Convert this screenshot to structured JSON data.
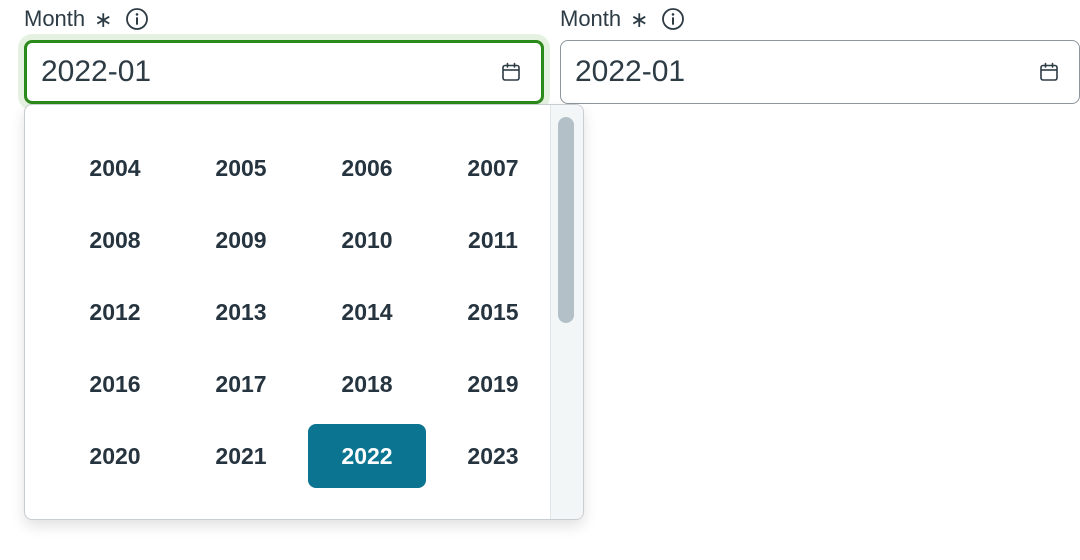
{
  "fields": [
    {
      "label": "Month",
      "required_mark": "∗",
      "value": "2022-01",
      "state": "focused"
    },
    {
      "label": "Month",
      "required_mark": "∗",
      "value": "2022-01",
      "state": "normal"
    }
  ],
  "picker": {
    "years": [
      "2004",
      "2005",
      "2006",
      "2007",
      "2008",
      "2009",
      "2010",
      "2011",
      "2012",
      "2013",
      "2014",
      "2015",
      "2016",
      "2017",
      "2018",
      "2019",
      "2020",
      "2021",
      "2022",
      "2023"
    ],
    "selected_year": "2022"
  },
  "colors": {
    "focus_border": "#2a8a1a",
    "selected_bg": "#0b7490",
    "text": "#2d3b45"
  },
  "icons": {
    "info": "info-circle-icon",
    "calendar": "calendar-icon"
  }
}
